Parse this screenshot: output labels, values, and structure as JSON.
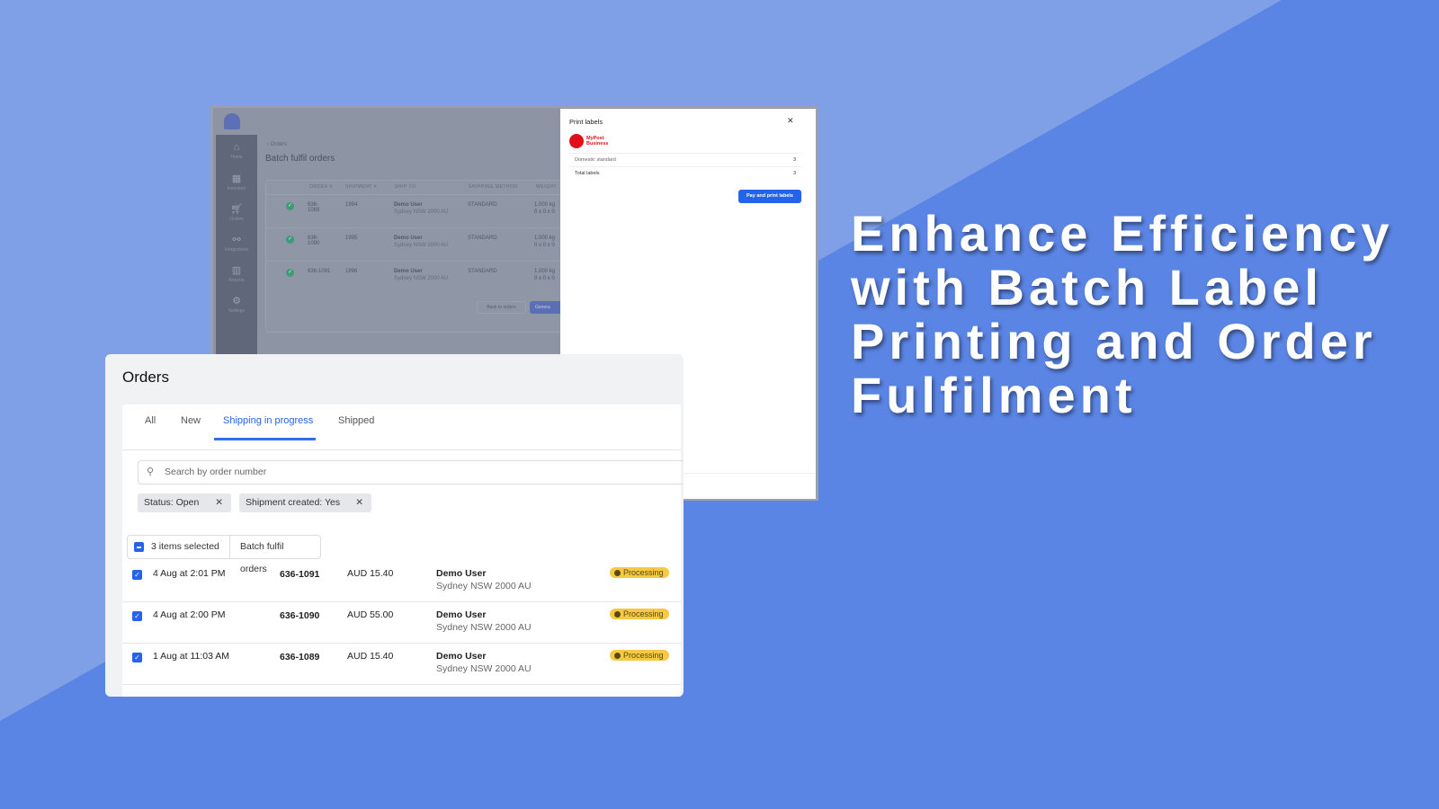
{
  "colors": {
    "bg_light": "#7fa0e6",
    "bg_dark": "#5b85e5",
    "accent": "#2563eb",
    "status": "#f6c945"
  },
  "headline": "Enhance Efficiency with Batch Label Printing and Order Fulfilment",
  "back_app": {
    "sidebar": [
      {
        "icon": "home-icon",
        "label": "Home"
      },
      {
        "icon": "inventory-icon",
        "label": "Inventory"
      },
      {
        "icon": "cart-icon",
        "label": "Orders"
      },
      {
        "icon": "share-icon",
        "label": "Integrations"
      },
      {
        "icon": "chart-icon",
        "label": "Reports"
      },
      {
        "icon": "gear-icon",
        "label": "Settings"
      }
    ],
    "breadcrumb": "Orders",
    "title": "Batch fulfil orders",
    "columns": [
      "ORDER #",
      "SHIPMENT #",
      "SHIP TO",
      "SHIPPING METHOD",
      "WEIGHT"
    ],
    "rows": [
      {
        "order": "636-1089",
        "shipment": "1994",
        "name": "Demo User",
        "address": "Sydney NSW 2000 AU",
        "method": "STANDARD",
        "weight": "1.000 kg",
        "dims": "0 x 0 x 0"
      },
      {
        "order": "636-1090",
        "shipment": "1995",
        "name": "Demo User",
        "address": "Sydney NSW 2000 AU",
        "method": "STANDARD",
        "weight": "1.000 kg",
        "dims": "0 x 0 x 0"
      },
      {
        "order": "636-1091",
        "shipment": "1996",
        "name": "Demo User",
        "address": "Sydney NSW 2000 AU",
        "method": "STANDARD",
        "weight": "1.000 kg",
        "dims": "0 x 0 x 0"
      }
    ],
    "back_button": "Back to orders",
    "generate_button": "Genera"
  },
  "modal": {
    "title": "Print labels",
    "logo_text": "MyPost Business",
    "rows": [
      {
        "label": "Domestic standard",
        "value": "3"
      },
      {
        "label": "Total labels",
        "value": "3"
      }
    ],
    "pay_button": "Pay and print labels"
  },
  "orders": {
    "title": "Orders",
    "tabs": [
      "All",
      "New",
      "Shipping in progress",
      "Shipped"
    ],
    "active_tab": "Shipping in progress",
    "search_placeholder": "Search by order number",
    "filters": [
      "Status: Open",
      "Shipment created: Yes"
    ],
    "selected_label": "3 items selected",
    "batch_button": "Batch fulfil orders",
    "rows": [
      {
        "date": "4 Aug at 2:01 PM",
        "order": "636-1091",
        "amount": "AUD 15.40",
        "name": "Demo User",
        "address": "Sydney NSW 2000 AU",
        "status": "Processing",
        "checked": true
      },
      {
        "date": "4 Aug at 2:00 PM",
        "order": "636-1090",
        "amount": "AUD 55.00",
        "name": "Demo User",
        "address": "Sydney NSW 2000 AU",
        "status": "Processing",
        "checked": true
      },
      {
        "date": "1 Aug at 11:03 AM",
        "order": "636-1089",
        "amount": "AUD 15.40",
        "name": "Demo User",
        "address": "Sydney NSW 2000 AU",
        "status": "Processing",
        "checked": true
      }
    ]
  }
}
